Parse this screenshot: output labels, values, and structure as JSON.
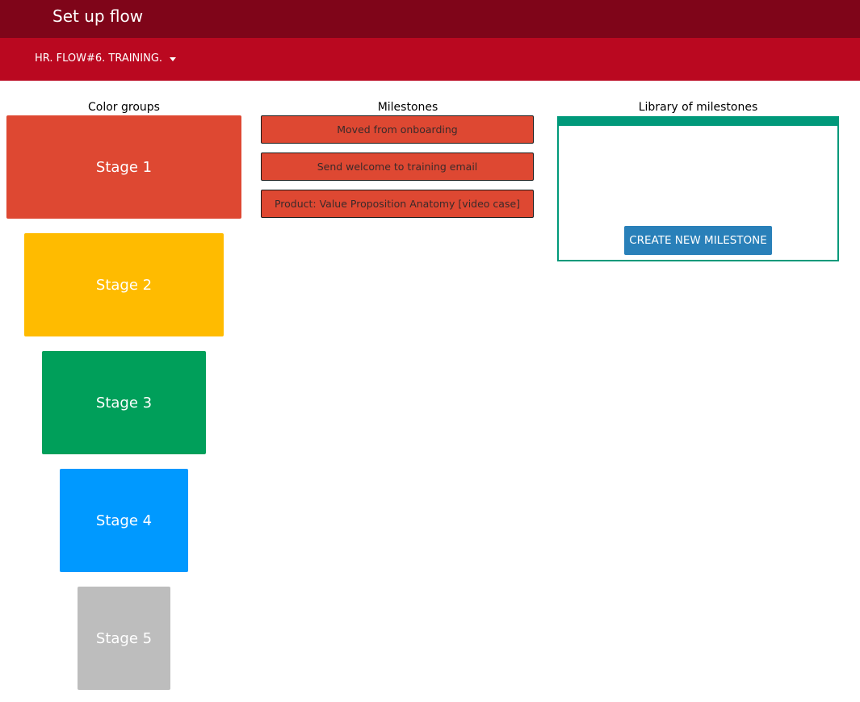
{
  "header": {
    "title": "Set up flow",
    "flow_selector": "HR. FLOW#6. TRAINING.",
    "bg_top": "#7f0519",
    "bg_sub": "#ba0820"
  },
  "color_groups": {
    "heading": "Color groups",
    "stages": [
      {
        "label": "Stage 1",
        "color": "#de4832"
      },
      {
        "label": "Stage 2",
        "color": "#ffbb00"
      },
      {
        "label": "Stage 3",
        "color": "#009f5a"
      },
      {
        "label": "Stage 4",
        "color": "#0099ff"
      },
      {
        "label": "Stage 5",
        "color": "#bdbdbd"
      }
    ]
  },
  "milestones": {
    "heading": "Milestones",
    "color": "#de4832",
    "items": [
      "Moved from onboarding",
      "Send welcome to training email",
      "Product: Value Proposition Anatomy [video case]"
    ]
  },
  "library": {
    "heading": "Library of milestones",
    "accent": "#00997a",
    "create_label": "CREATE NEW MILESTONE",
    "button_color": "#2980b9"
  }
}
